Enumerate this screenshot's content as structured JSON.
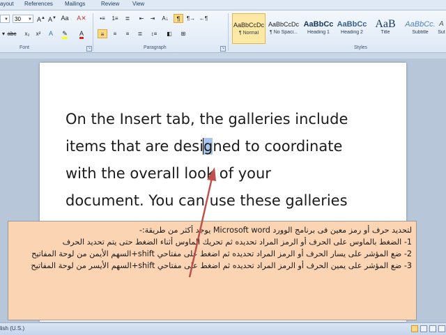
{
  "ribbon": {
    "tabs": [
      "ayout",
      "References",
      "Mailings",
      "Review",
      "View"
    ],
    "font": {
      "size": "30",
      "group_label": "Font"
    },
    "paragraph": {
      "group_label": "Paragraph"
    },
    "styles": {
      "group_label": "Styles",
      "items": [
        {
          "sample": "AaBbCcDc",
          "name": "¶ Normal",
          "selected": true
        },
        {
          "sample": "AaBbCcDc",
          "name": "¶ No Spaci..."
        },
        {
          "sample": "AaBbCc",
          "name": "Heading 1"
        },
        {
          "sample": "AaBbCc",
          "name": "Heading 2"
        },
        {
          "sample": "AaB",
          "name": "Title"
        },
        {
          "sample": "AaBbCc.",
          "name": "Subtitle"
        },
        {
          "sample": "A",
          "name": "Sut"
        }
      ]
    }
  },
  "document": {
    "lines": [
      "On the Insert tab, the galleries include",
      "items that are desi",
      "with the overall look of your",
      "document. You can use these galleries"
    ],
    "line2_selected": "g",
    "line2_rest": "ned to coordinate"
  },
  "note": {
    "lines": [
      "لتحديد حرف أو رمز معين فى برنامج الوورد Microsoft word يوجد أكثر من طريقة:-",
      "1- الضغط بالماوس على الحرف أو الرمز المراد تحديده ثم تحريك الماوس أثناء الضغط حتى يتم تحديد الحرف",
      "2- ضع المؤشر على يسار الحرف أو الرمز المراد تحديده ثم اضغط على مفتاحي shift+السهم الأيمن من لوحة المفاتيح",
      "3- ضع المؤشر على يمين الحرف أو الرمز المراد تحديده ثم اضغط على مفتاحي shift+السهم الأيسر من لوحة المفاتيح"
    ]
  },
  "statusbar": {
    "language": "lish (U.S.)"
  },
  "colors": {
    "note_bg": "#fbd4b4",
    "selection": "#a9c5ec",
    "arrow": "#c0504d",
    "active_button": "#fcd885"
  }
}
